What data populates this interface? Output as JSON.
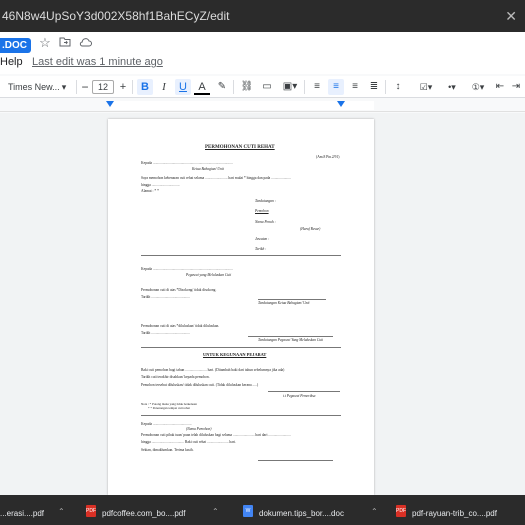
{
  "browser": {
    "url": "46N8w4UpSoY3d002X58hf1BahECyZ/edit"
  },
  "docs": {
    "doc_badge": ".DOC",
    "menu_help": "Help",
    "last_edit": "Last edit was 1 minute ago",
    "font_name": "Times New...",
    "font_size": "12",
    "bold": "B",
    "italic": "I",
    "underline": "U",
    "text_color": "A"
  },
  "page": {
    "title": "PERMOHONAN CUTI REHAT",
    "form_code": "(Am.8 Pin.2/91)",
    "lines": [
      "Kepada .........................................................................................",
      "Ketua Bahagian/ Unit",
      "Saya memohon kebenaran cuti rehat selama ......................... hari mulai * hingga dan pada ......................",
      "hingga ...............................",
      "Alamat : * *",
      "Tandatangan :",
      "Pemohon",
      "Nama Penuh :",
      "(Huruf Besar)",
      "Jawatan :",
      "Tarikh :",
      "Kepada .........................................................................................",
      "Pegawai yang Meluluskan Cuti",
      "Permohonan cuti di atas *Disokong/ tidak disokong.",
      "Tarikh ...........................................",
      "Tandatangan Ketua Bahagian/ Unit",
      "Permohonan cuti di atas *diluluskan/ tidak diluluskan.",
      "Tarikh ...........................................",
      "Tandatangan Pegawai Yang Meluluskan Cuti",
      "UNTUK KEGUNAAN PEJABAT",
      "Baki cuti pemohon bagi tahun ........................ hari. (Ditambah baki dari tahun sebelumnya jika ada)",
      "Tarikh cuti terakhir disahkan/ kepada pemohon.",
      "Pemohon tersebut diluluskan/ tidak diluluskan cuti. (Tidak diluluskan kerana .....)",
      "t.t Pegawai Pemeriksa",
      "Nota : * Potong mana yang tidak berkenaan",
      "* * Penerangan tempat cuti rehat",
      "Kepada ...........................................",
      "(Nama Pemohon)",
      "Permohonan cuti pihak tuan/ puan telah diluluskan bagi selama ........................ hari dari .........................",
      "hingga .................................... Baki cuti rehat ........................ hari.",
      "Sekian, dimaklumkan. Terima kasih."
    ]
  },
  "downloads": [
    {
      "name": "...erasi....pdf"
    },
    {
      "name": "pdfcoffee.com_bo....pdf"
    },
    {
      "name": "dokumen.tips_bor....doc"
    },
    {
      "name": "pdf-rayuan-trib_co....pdf"
    }
  ],
  "icons": {
    "star": "star-icon",
    "folder": "folder-move-icon",
    "cloud": "cloud-saved-icon"
  },
  "colors": {
    "accent": "#1a73e8",
    "download_bar": "#2b2b2b",
    "pdf_red": "#d93025"
  }
}
